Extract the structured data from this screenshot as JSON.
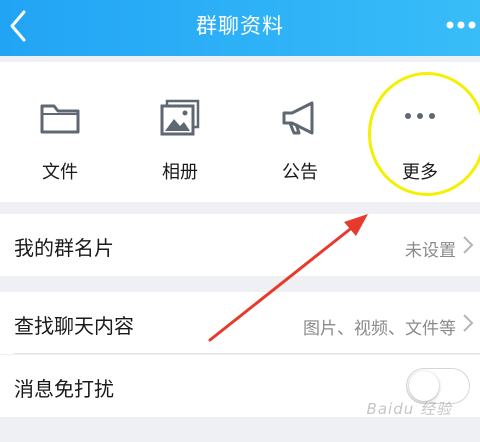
{
  "header": {
    "title": "群聊资料",
    "back_icon": "chevron-left-icon",
    "more_icon": "more-dots-icon",
    "bg_color": "#2aa9f7"
  },
  "actions": [
    {
      "label": "文件",
      "icon": "folder-icon"
    },
    {
      "label": "相册",
      "icon": "album-icon"
    },
    {
      "label": "公告",
      "icon": "megaphone-icon"
    },
    {
      "label": "更多",
      "icon": "more-dots-icon"
    }
  ],
  "rows": {
    "group_card": {
      "label": "我的群名片",
      "value": "未设置"
    },
    "search_chat": {
      "label": "查找聊天内容",
      "value": "图片、视频、文件等"
    },
    "mute": {
      "label": "消息免打扰",
      "enabled": false
    }
  },
  "annotation": {
    "highlight_color": "#f4f000",
    "arrow_color": "#e83a2c"
  },
  "watermark": "Baidu 经验"
}
